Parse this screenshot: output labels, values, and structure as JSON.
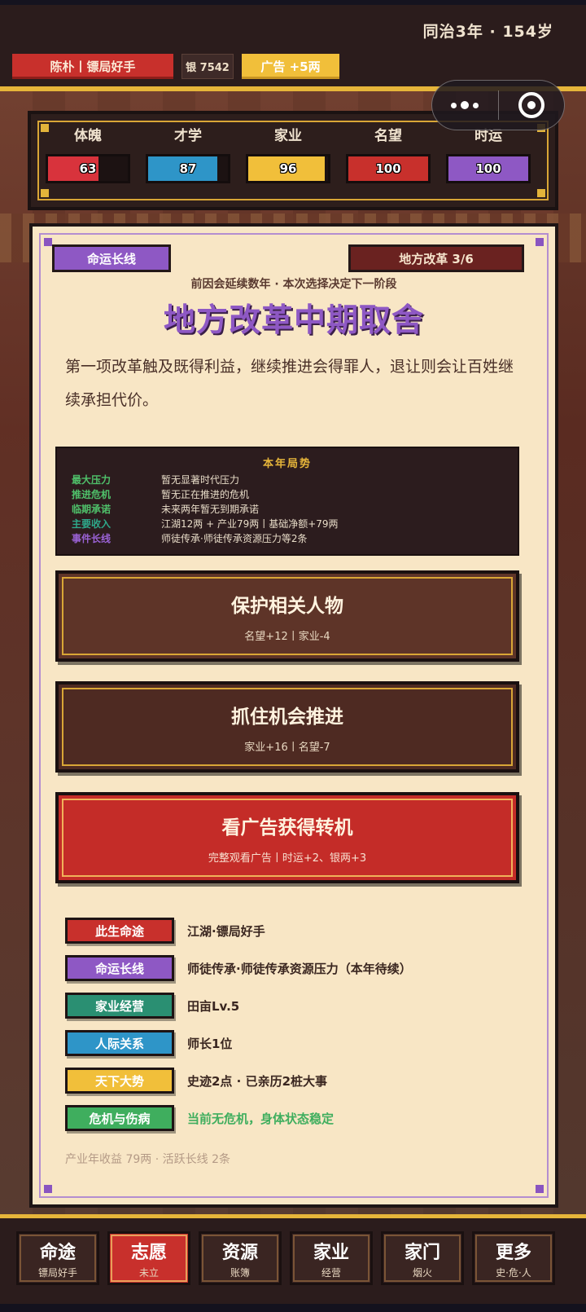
{
  "header": {
    "era": "同治3年 · 154岁",
    "name_chip": "陈朴丨镖局好手",
    "silver_chip": "银 7542",
    "ad_chip": "广告 +5两"
  },
  "stats": [
    {
      "label": "体魄",
      "value": "63",
      "fill": 0.63,
      "color": "#d8333c"
    },
    {
      "label": "才学",
      "value": "87",
      "fill": 0.87,
      "color": "#2e95c8"
    },
    {
      "label": "家业",
      "value": "96",
      "fill": 0.96,
      "color": "#f1bf3a"
    },
    {
      "label": "名望",
      "value": "100",
      "fill": 1.0,
      "color": "#c8302c"
    },
    {
      "label": "时运",
      "value": "100",
      "fill": 1.0,
      "color": "#8e58c4"
    }
  ],
  "event": {
    "destiny_tag": "命运长线",
    "stage_tag": "地方改革 3/6",
    "subhead": "前因会延续数年 · 本次选择决定下一阶段",
    "title": "地方改革中期取舍",
    "description": "第一项改革触及既得利益，继续推进会得罪人，退让则会让百姓继续承担代价。"
  },
  "situation": {
    "heading": "本年局势",
    "rows": [
      {
        "key": "最大压力",
        "value": "暂无显著时代压力",
        "color": "#4fc06a"
      },
      {
        "key": "推进危机",
        "value": "暂无正在推进的危机",
        "color": "#4fc06a"
      },
      {
        "key": "临期承诺",
        "value": "未来两年暂无到期承诺",
        "color": "#4fc06a"
      },
      {
        "key": "主要收入",
        "value": "江湖12两 + 产业79两丨基础净额+79两",
        "color": "#2ea88a"
      },
      {
        "key": "事件长线",
        "value": "师徒传承·师徒传承资源压力等2条",
        "color": "#9a62d6"
      }
    ]
  },
  "choices": [
    {
      "title": "保护相关人物",
      "effect": "名望+12丨家业-4"
    },
    {
      "title": "抓住机会推进",
      "effect": "家业+16丨名望-7"
    },
    {
      "title": "看广告获得转机",
      "effect": "完整观看广告丨时运+2、银两+3"
    }
  ],
  "info": [
    {
      "badge": "此生命途",
      "text": "江湖·镖局好手",
      "color": "#c8302c"
    },
    {
      "badge": "命运长线",
      "text": "师徒传承·师徒传承资源压力（本年待续）",
      "color": "#8e58c4"
    },
    {
      "badge": "家业经营",
      "text": "田亩Lv.5",
      "color": "#2a8f72"
    },
    {
      "badge": "人际关系",
      "text": "师长1位",
      "color": "#2e95c8"
    },
    {
      "badge": "天下大势",
      "text": "史迹2点 · 已亲历2桩大事",
      "color": "#f1bf3a"
    },
    {
      "badge": "危机与伤病",
      "text": "当前无危机，身体状态稳定",
      "color": "#3fae5e"
    }
  ],
  "footnote": "产业年收益 79两 · 活跃长线 2条",
  "nav": [
    {
      "title": "命途",
      "sub": "镖局好手"
    },
    {
      "title": "志愿",
      "sub": "未立"
    },
    {
      "title": "资源",
      "sub": "账簿"
    },
    {
      "title": "家业",
      "sub": "经营"
    },
    {
      "title": "家门",
      "sub": "烟火"
    },
    {
      "title": "更多",
      "sub": "史·危·人"
    }
  ]
}
